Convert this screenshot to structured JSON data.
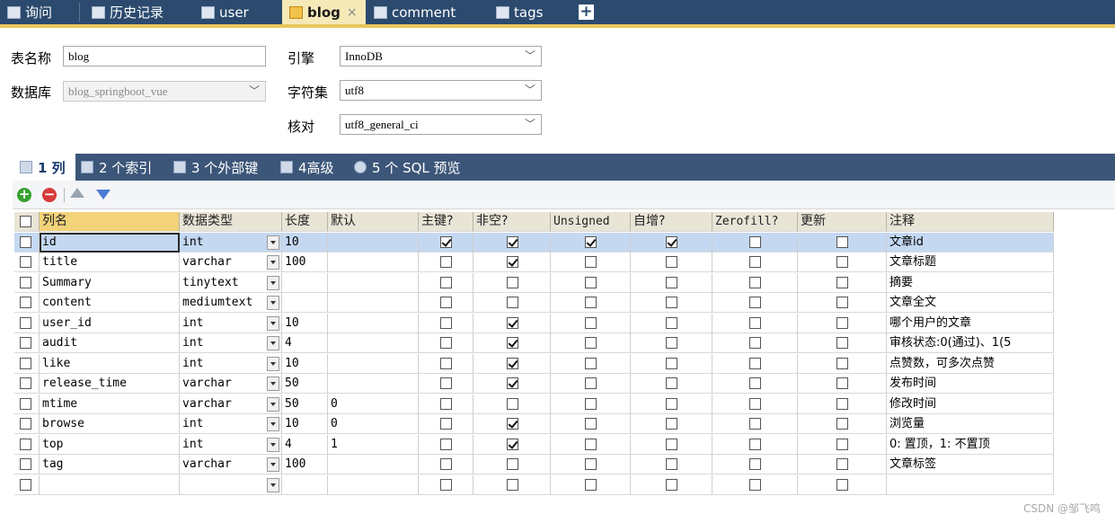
{
  "top_tabs": [
    {
      "label": "询问",
      "icon": "query-icon"
    },
    {
      "label": "历史记录",
      "icon": "history-icon"
    },
    {
      "label": "user",
      "icon": "table-icon"
    },
    {
      "label": "blog",
      "icon": "table-edit-icon",
      "close": "×"
    },
    {
      "label": "comment",
      "icon": "table-icon"
    },
    {
      "label": "tags",
      "icon": "table-icon"
    }
  ],
  "add_tab": "+",
  "form": {
    "table_name_label": "表名称",
    "table_name_value": "blog",
    "database_label": "数据库",
    "database_value": "blog_springboot_vue",
    "engine_label": "引擎",
    "engine_value": "InnoDB",
    "charset_label": "字符集",
    "charset_value": "utf8",
    "collation_label": "核对",
    "collation_value": "utf8_general_ci"
  },
  "sub_tabs": [
    "1 列",
    "2 个索引",
    "3 个外部键",
    "4高级",
    "5 个 SQL 预览"
  ],
  "columns_header": [
    "列名",
    "数据类型",
    "长度",
    "默认",
    "主键?",
    "非空?",
    "Unsigned",
    "自增?",
    "Zerofill?",
    "更新",
    "注释"
  ],
  "rows": [
    {
      "name": "id",
      "type": "int",
      "len": "10",
      "def": "",
      "pk": true,
      "nn": true,
      "uns": true,
      "ai": true,
      "zf": false,
      "upd": false,
      "note": "文章id"
    },
    {
      "name": "title",
      "type": "varchar",
      "len": "100",
      "def": "",
      "pk": false,
      "nn": true,
      "uns": false,
      "ai": false,
      "zf": false,
      "upd": false,
      "note": "文章标题"
    },
    {
      "name": "Summary",
      "type": "tinytext",
      "len": "",
      "def": "",
      "pk": false,
      "nn": false,
      "uns": false,
      "ai": false,
      "zf": false,
      "upd": false,
      "note": "摘要"
    },
    {
      "name": "content",
      "type": "mediumtext",
      "len": "",
      "def": "",
      "pk": false,
      "nn": false,
      "uns": false,
      "ai": false,
      "zf": false,
      "upd": false,
      "note": "文章全文"
    },
    {
      "name": "user_id",
      "type": "int",
      "len": "10",
      "def": "",
      "pk": false,
      "nn": true,
      "uns": false,
      "ai": false,
      "zf": false,
      "upd": false,
      "note": "哪个用户的文章"
    },
    {
      "name": "audit",
      "type": "int",
      "len": "4",
      "def": "",
      "pk": false,
      "nn": true,
      "uns": false,
      "ai": false,
      "zf": false,
      "upd": false,
      "note": "审核状态:0(通过)、1(5"
    },
    {
      "name": "like",
      "type": "int",
      "len": "10",
      "def": "",
      "pk": false,
      "nn": true,
      "uns": false,
      "ai": false,
      "zf": false,
      "upd": false,
      "note": "点赞数，可多次点赞"
    },
    {
      "name": "release_time",
      "type": "varchar",
      "len": "50",
      "def": "",
      "pk": false,
      "nn": true,
      "uns": false,
      "ai": false,
      "zf": false,
      "upd": false,
      "note": "发布时间"
    },
    {
      "name": "mtime",
      "type": "varchar",
      "len": "50",
      "def": "0",
      "pk": false,
      "nn": false,
      "uns": false,
      "ai": false,
      "zf": false,
      "upd": false,
      "note": "修改时间"
    },
    {
      "name": "browse",
      "type": "int",
      "len": "10",
      "def": "0",
      "pk": false,
      "nn": true,
      "uns": false,
      "ai": false,
      "zf": false,
      "upd": false,
      "note": "浏览量"
    },
    {
      "name": "top",
      "type": "int",
      "len": "4",
      "def": "1",
      "pk": false,
      "nn": true,
      "uns": false,
      "ai": false,
      "zf": false,
      "upd": false,
      "note": "0: 置顶，1: 不置顶"
    },
    {
      "name": "tag",
      "type": "varchar",
      "len": "100",
      "def": "",
      "pk": false,
      "nn": false,
      "uns": false,
      "ai": false,
      "zf": false,
      "upd": false,
      "note": "文章标签"
    },
    {
      "name": "",
      "type": "",
      "len": "",
      "def": "",
      "pk": false,
      "nn": false,
      "uns": false,
      "ai": false,
      "zf": false,
      "upd": false,
      "note": ""
    }
  ],
  "watermark": "CSDN @邹飞鸣",
  "colors": {
    "topbar": "#2b4a6e",
    "active_tab": "#f6e9b8",
    "selected_row": "#c4d8f2",
    "header": "#e8e4d6"
  }
}
